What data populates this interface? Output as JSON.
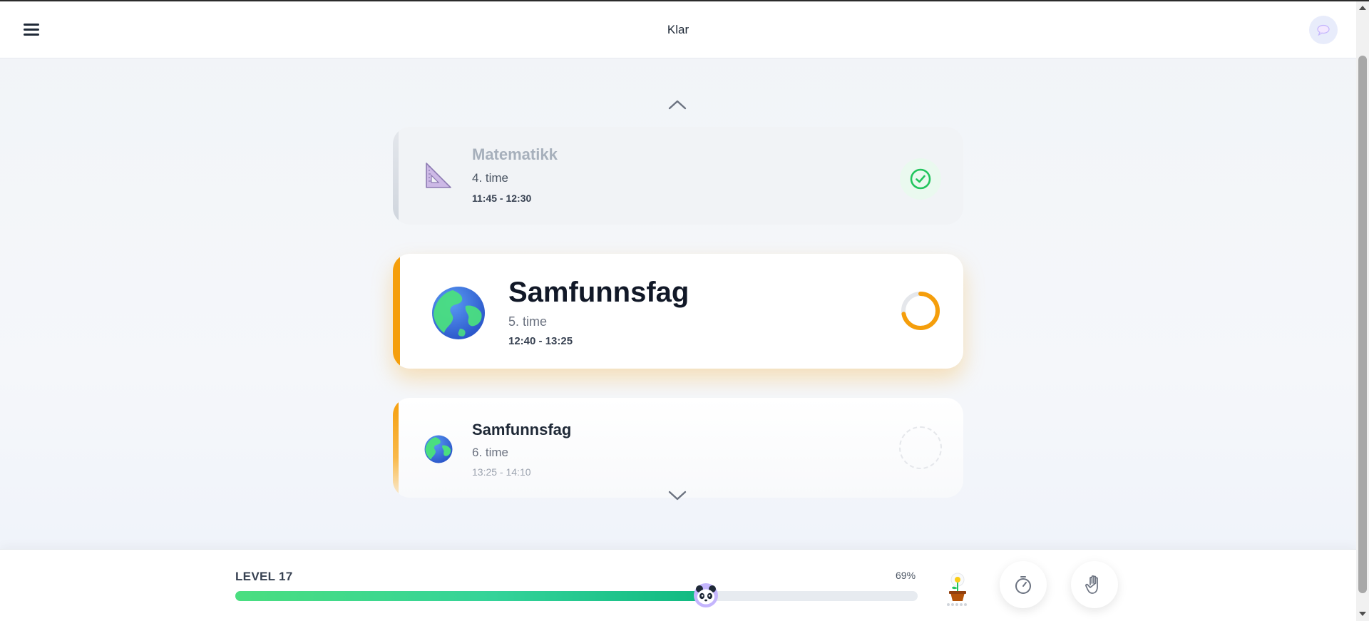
{
  "header": {
    "title": "Klar",
    "menu_icon": "hamburger-menu-icon",
    "chat_icon": "speech-bubble-icon"
  },
  "nav": {
    "up_icon": "chevron-up-icon",
    "down_icon": "chevron-down-icon"
  },
  "lessons": [
    {
      "subject": "Matematikk",
      "period": "4. time",
      "time": "11:45 - 12:30",
      "icon": "triangle-ruler-icon",
      "status": "done",
      "status_icon": "check-circle-icon"
    },
    {
      "subject": "Samfunnsfag",
      "period": "5. time",
      "time": "12:40 - 13:25",
      "icon": "globe-icon",
      "status": "in-progress",
      "progress": 0.72
    },
    {
      "subject": "Samfunnsfag",
      "period": "6. time",
      "time": "13:25 - 14:10",
      "icon": "globe-icon",
      "status": "upcoming"
    }
  ],
  "footer": {
    "level_label": "LEVEL 17",
    "progress_percent": "69%",
    "progress_value": 0.69,
    "avatar_icon": "panda-icon",
    "plant_icon": "potted-flower-icon",
    "timer_icon": "stopwatch-icon",
    "hand_icon": "raised-hand-icon"
  },
  "colors": {
    "accent": "#f59e0b",
    "progress_green": "#10b981",
    "done_green": "#22c55e"
  }
}
